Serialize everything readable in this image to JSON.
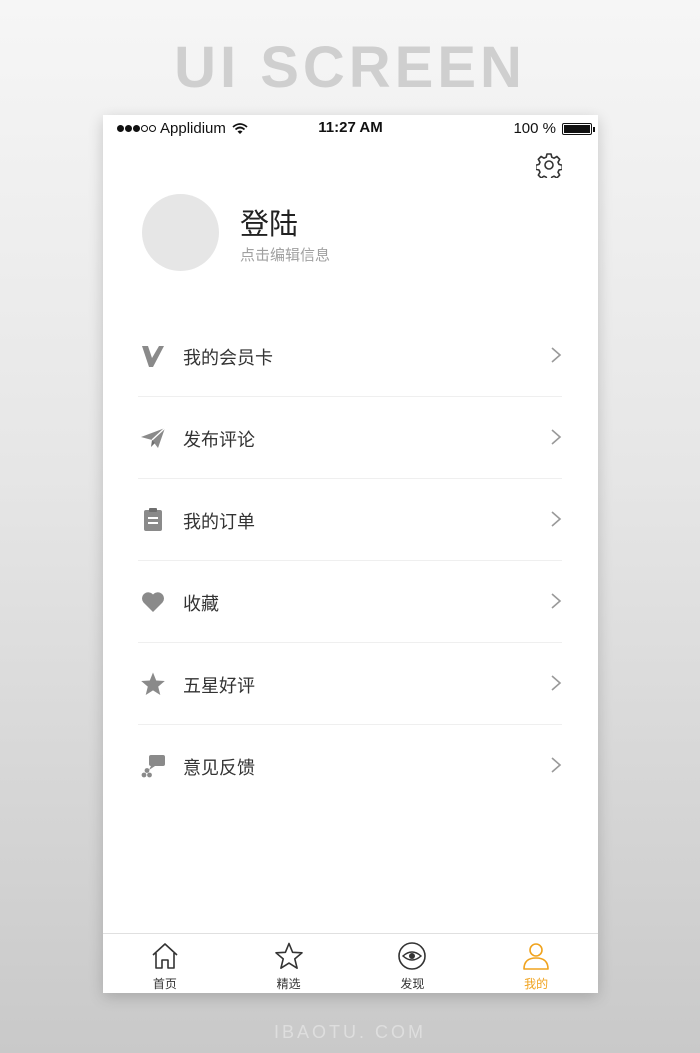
{
  "poster": {
    "title": "UI SCREEN",
    "footer": "IBAOTU. COM"
  },
  "status_bar": {
    "carrier": "Applidium",
    "time": "11:27 AM",
    "battery": "100 %"
  },
  "profile": {
    "title": "登陆",
    "subtitle": "点击编辑信息"
  },
  "menu": [
    {
      "label": "我的会员卡",
      "icon": "vip-card-icon"
    },
    {
      "label": "发布评论",
      "icon": "paper-plane-icon"
    },
    {
      "label": "我的订单",
      "icon": "clipboard-icon"
    },
    {
      "label": "收藏",
      "icon": "heart-icon"
    },
    {
      "label": "五星好评",
      "icon": "star-icon"
    },
    {
      "label": "意见反馈",
      "icon": "chat-bubble-icon"
    }
  ],
  "tabbar": [
    {
      "label": "首页",
      "icon": "home-icon"
    },
    {
      "label": "精选",
      "icon": "star-outline-icon"
    },
    {
      "label": "发现",
      "icon": "eye-icon"
    },
    {
      "label": "我的",
      "icon": "user-icon",
      "active": true
    }
  ],
  "colors": {
    "accent": "#f0a31e",
    "icon_gray": "#8a8a8a",
    "text": "#333333"
  }
}
